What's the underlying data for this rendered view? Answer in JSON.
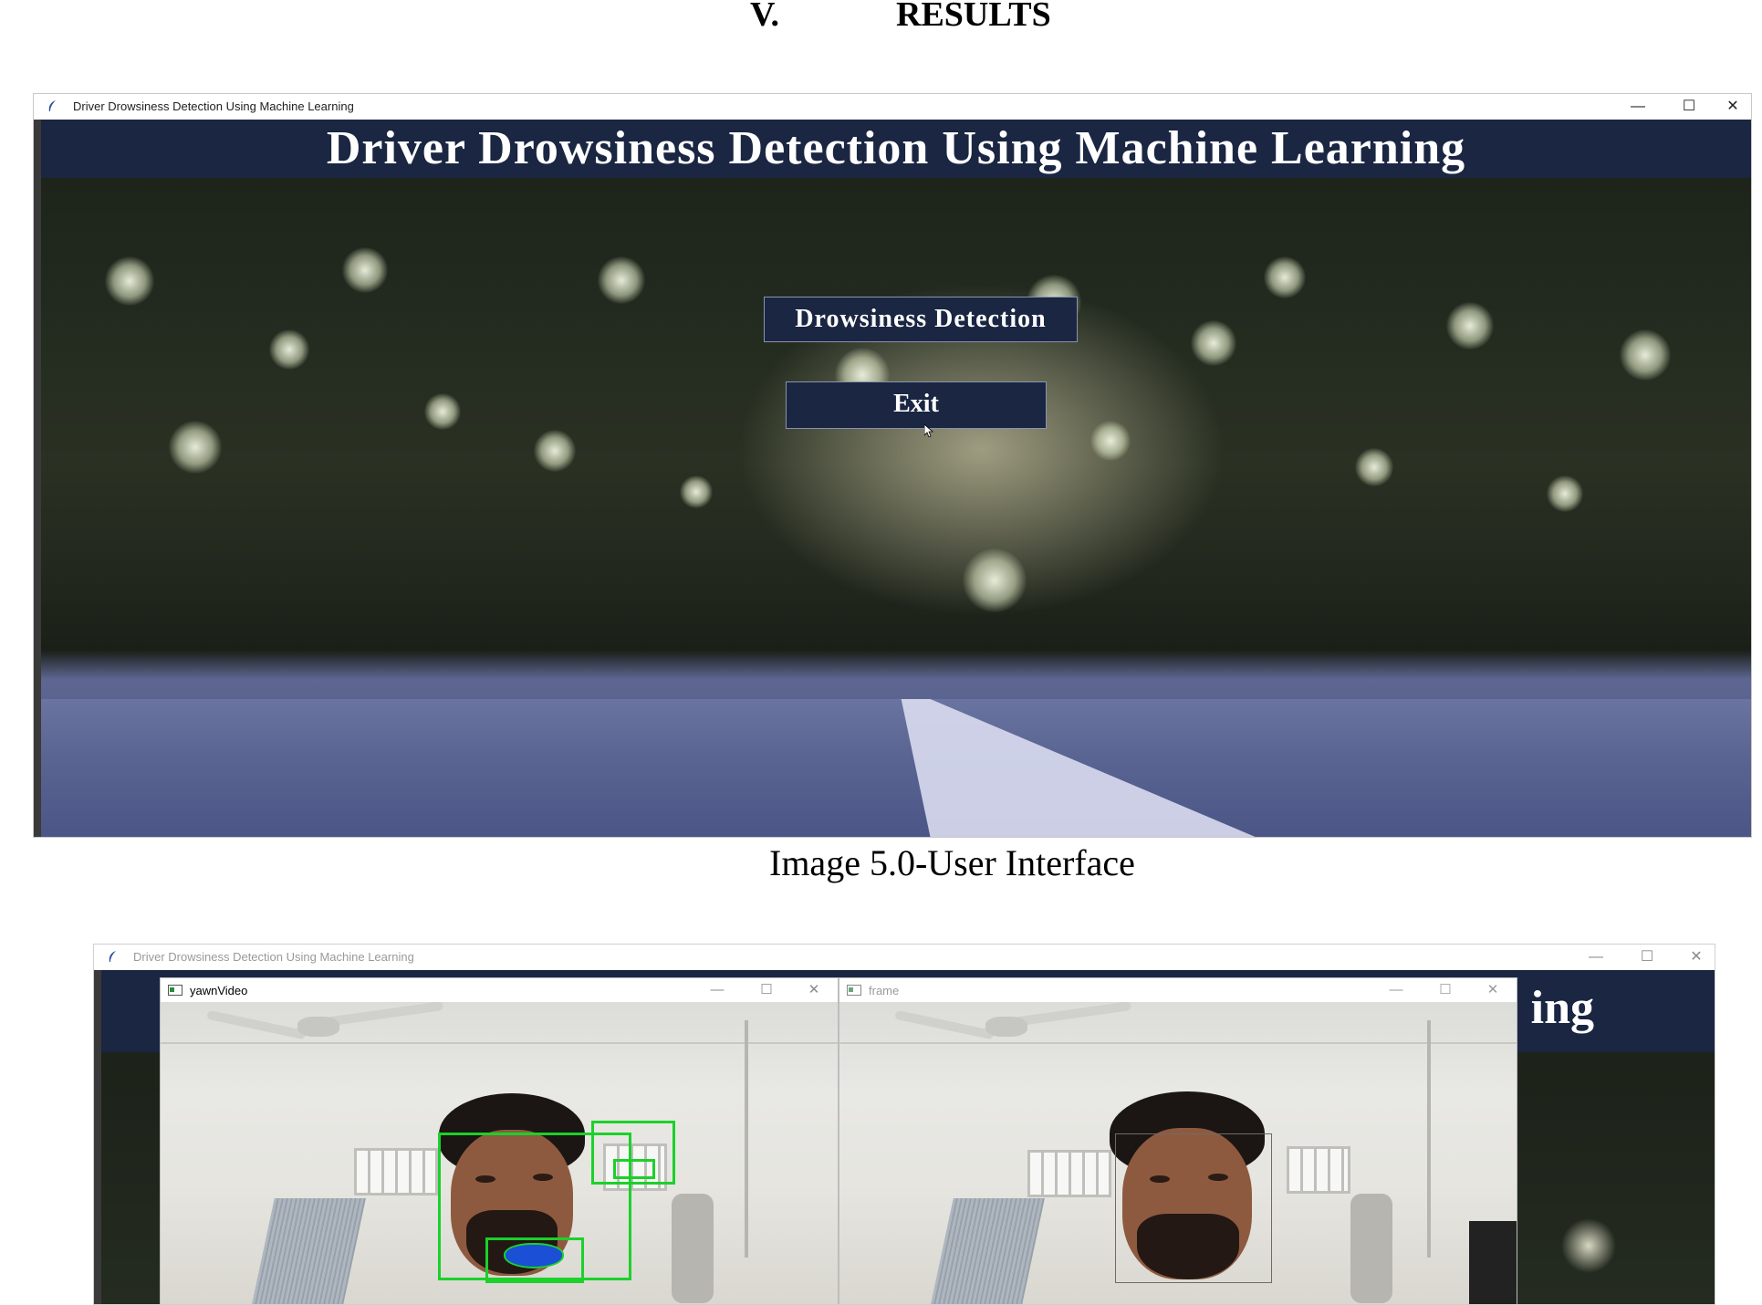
{
  "section": {
    "number": "V.",
    "title": "RESULTS"
  },
  "figure1": {
    "window_title": "Driver Drowsiness Detection Using Machine Learning",
    "header": "Driver Drowsiness Detection Using Machine Learning",
    "buttons": {
      "detect": "Drowsiness Detection",
      "exit": "Exit"
    },
    "window_controls": {
      "minimize": "—",
      "maximize": "☐",
      "close": "✕"
    },
    "caption": "Image 5.0-User Interface"
  },
  "figure2": {
    "window_title": "Driver Drowsiness Detection Using Machine Learning",
    "header_fragment": "ing",
    "windows": [
      {
        "title": "yawnVideo"
      },
      {
        "title": "frame"
      }
    ],
    "window_controls": {
      "minimize": "—",
      "maximize": "☐",
      "close": "✕"
    },
    "colors": {
      "detection_box": "#1bd12a",
      "mouth_mask": "#1a4fd6",
      "header_band": "#1a2642"
    }
  }
}
